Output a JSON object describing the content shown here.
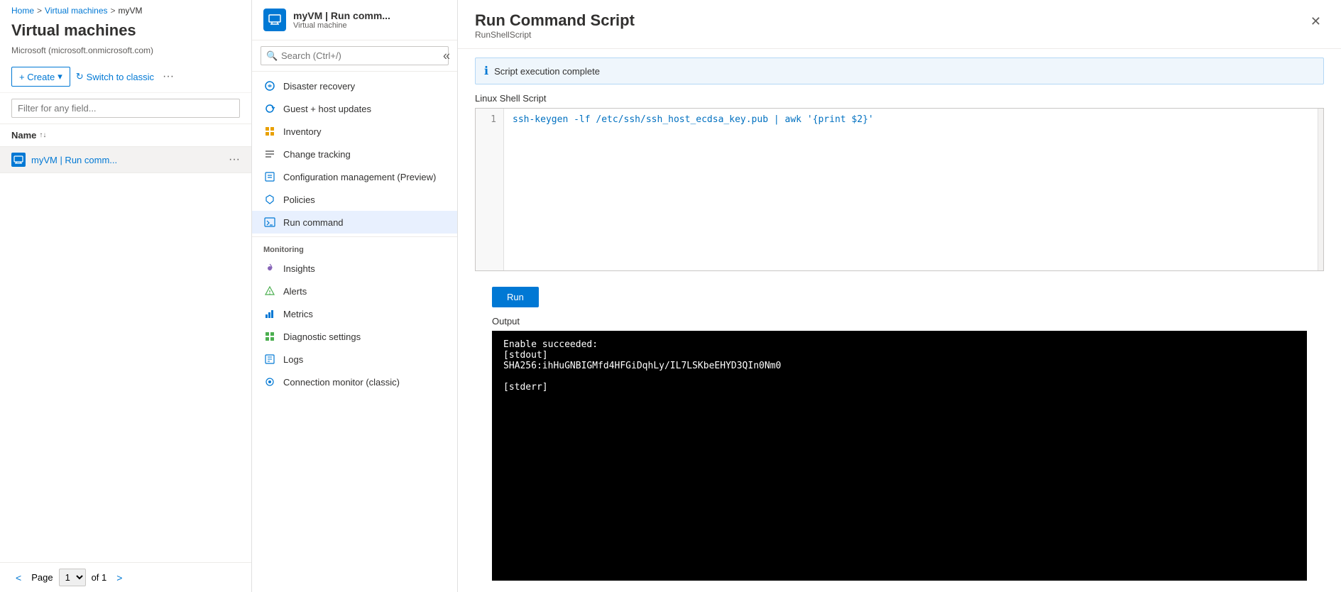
{
  "breadcrumb": {
    "home": "Home",
    "sep1": ">",
    "vms": "Virtual machines",
    "sep2": ">",
    "current": "myVM"
  },
  "leftPanel": {
    "title": "Virtual machines",
    "subtitle": "Microsoft (microsoft.onmicrosoft.com)",
    "createLabel": "+ Create",
    "switchLabel": "Switch to classic",
    "moreLabel": "···",
    "filterPlaceholder": "Filter for any field...",
    "nameHeader": "Name",
    "vms": [
      {
        "name": "myVM"
      }
    ],
    "pagination": {
      "prev": "<",
      "page": "1",
      "ofLabel": "of 1",
      "next": ">"
    }
  },
  "middlePanel": {
    "vmTitle": "myVM | Run comm...",
    "vmSub": "Virtual machine",
    "searchPlaceholder": "Search (Ctrl+/)",
    "sections": {
      "monitoring": "Monitoring"
    },
    "items": [
      {
        "id": "disaster-recovery",
        "label": "Disaster recovery",
        "icon": "cloud"
      },
      {
        "id": "guest-host-updates",
        "label": "Guest + host updates",
        "icon": "refresh"
      },
      {
        "id": "inventory",
        "label": "Inventory",
        "icon": "list"
      },
      {
        "id": "change-tracking",
        "label": "Change tracking",
        "icon": "tracking"
      },
      {
        "id": "config-mgmt",
        "label": "Configuration management (Preview)",
        "icon": "config"
      },
      {
        "id": "policies",
        "label": "Policies",
        "icon": "shield"
      },
      {
        "id": "run-command",
        "label": "Run command",
        "icon": "terminal",
        "active": true
      },
      {
        "id": "insights",
        "label": "Insights",
        "icon": "insights"
      },
      {
        "id": "alerts",
        "label": "Alerts",
        "icon": "alert"
      },
      {
        "id": "metrics",
        "label": "Metrics",
        "icon": "chart"
      },
      {
        "id": "diagnostic-settings",
        "label": "Diagnostic settings",
        "icon": "settings"
      },
      {
        "id": "logs",
        "label": "Logs",
        "icon": "logs"
      },
      {
        "id": "connection-monitor",
        "label": "Connection monitor (classic)",
        "icon": "monitor"
      }
    ]
  },
  "rightPanel": {
    "title": "Run Command Script",
    "subtitle": "RunShellScript",
    "closeLabel": "✕",
    "infoBanner": "Script execution complete",
    "scriptLabel": "Linux Shell Script",
    "lineNumber": "1",
    "scriptCode": "ssh-keygen -lf /etc/ssh/ssh_host_ecdsa_key.pub | awk '{print $2}'",
    "runButton": "Run",
    "outputLabel": "Output",
    "outputLines": [
      "Enable succeeded:",
      "[stdout]",
      "SHA256:ihHuGNBIGMfd4HFGiDqhLy/IL7LSKbeEHYD3QIn0Nm0",
      "",
      "[stderr]"
    ]
  }
}
